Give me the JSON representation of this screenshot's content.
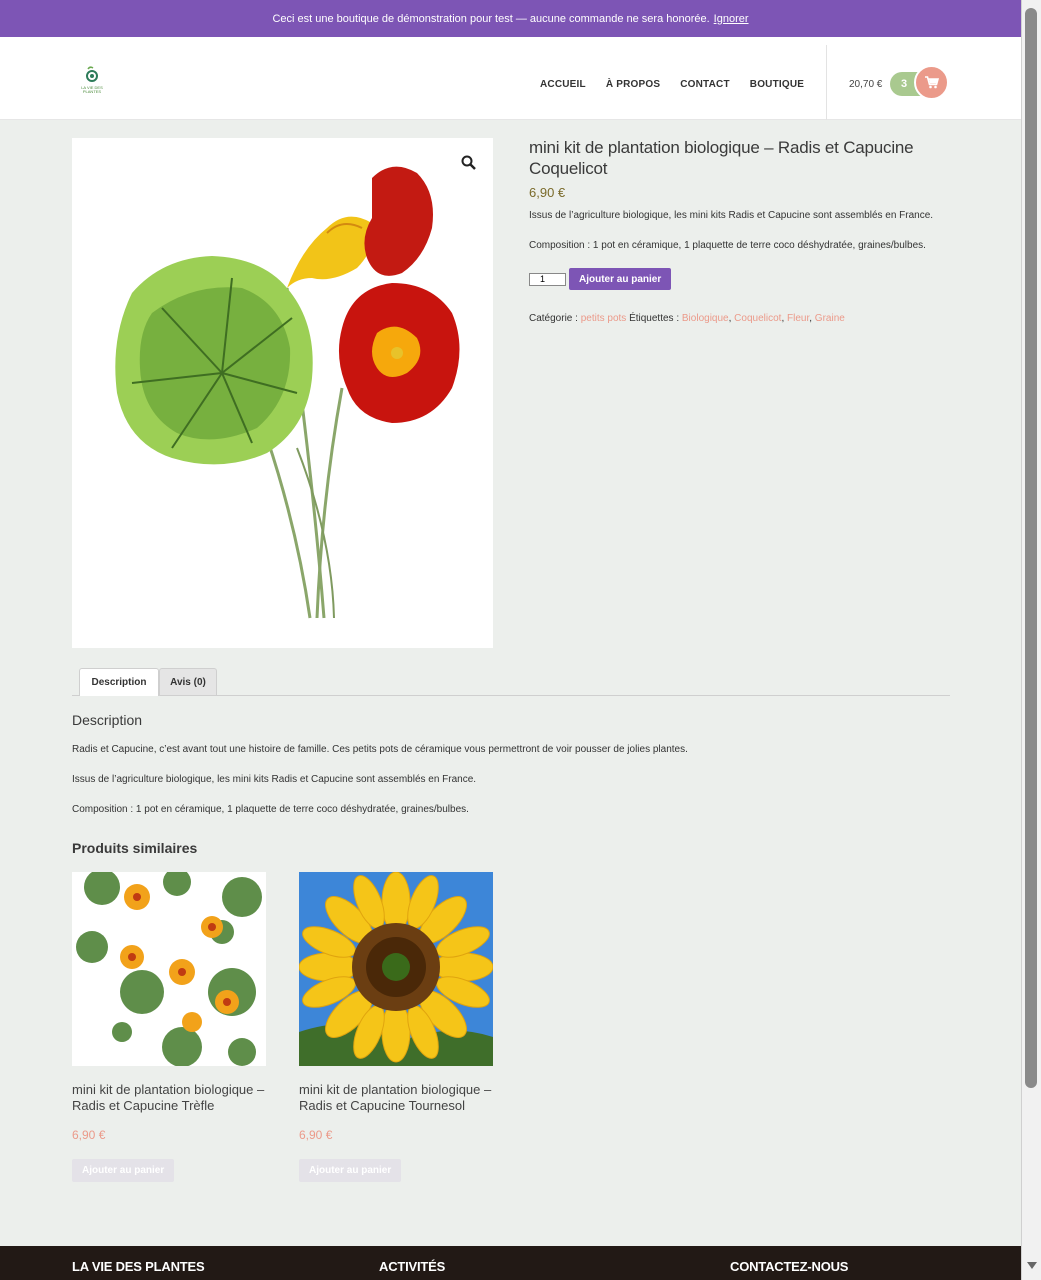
{
  "store_notice": {
    "text": "Ceci est une boutique de démonstration pour test — aucune commande ne sera honorée.",
    "dismiss_label": "Ignorer"
  },
  "header": {
    "logo_text": "LA VIE DES PLANTES",
    "nav": [
      "ACCUEIL",
      "À PROPOS",
      "CONTACT",
      "BOUTIQUE"
    ],
    "cart_total": "20,70 €",
    "cart_count": "3",
    "cart_icon": "shopping-cart-icon"
  },
  "product": {
    "title": "mini kit de plantation biologique – Radis et Capucine Coquelicot",
    "price": "6,90 €",
    "short_description": [
      "Issus de l’agriculture biologique, les mini kits Radis et Capucine sont assemblés en France.",
      "Composition : 1 pot en céramique, 1 plaquette de terre coco déshydratée, graines/bulbes."
    ],
    "quantity": "1",
    "add_to_cart_label": "Ajouter au panier",
    "category_label": "Catégorie :",
    "category": "petits pots",
    "tags_label": "Étiquettes :",
    "tags": [
      "Biologique",
      "Coquelicot",
      "Fleur",
      "Graine"
    ],
    "zoom_icon": "magnifier-icon"
  },
  "tabs": {
    "description": "Description",
    "reviews": "Avis (0)"
  },
  "description": {
    "heading": "Description",
    "paragraphs": [
      "Radis et Capucine, c’est avant tout une histoire de famille. Ces petits pots de céramique vous permettront de voir pousser de jolies plantes.",
      "Issus de l’agriculture biologique, les mini kits Radis et Capucine sont assemblés en France.",
      "Composition : 1 pot en céramique, 1 plaquette de terre coco déshydratée, graines/bulbes."
    ]
  },
  "related": {
    "heading": "Produits similaires",
    "items": [
      {
        "name": "mini kit de plantation biologique – Radis et Capucine Trèfle",
        "price": "6,90 €",
        "button": "Ajouter au panier"
      },
      {
        "name": "mini kit de plantation biologique – Radis et Capucine Tournesol",
        "price": "6,90 €",
        "button": "Ajouter au panier"
      }
    ]
  },
  "footer": {
    "columns": [
      "LA VIE DES PLANTES",
      "ACTIVITÉS",
      "CONTACTEZ-NOUS"
    ]
  },
  "colors": {
    "accent_purple": "#7d55b5",
    "link_salmon": "#eb9a8a",
    "cart_green": "#a9c98f",
    "background": "#ecefec"
  }
}
